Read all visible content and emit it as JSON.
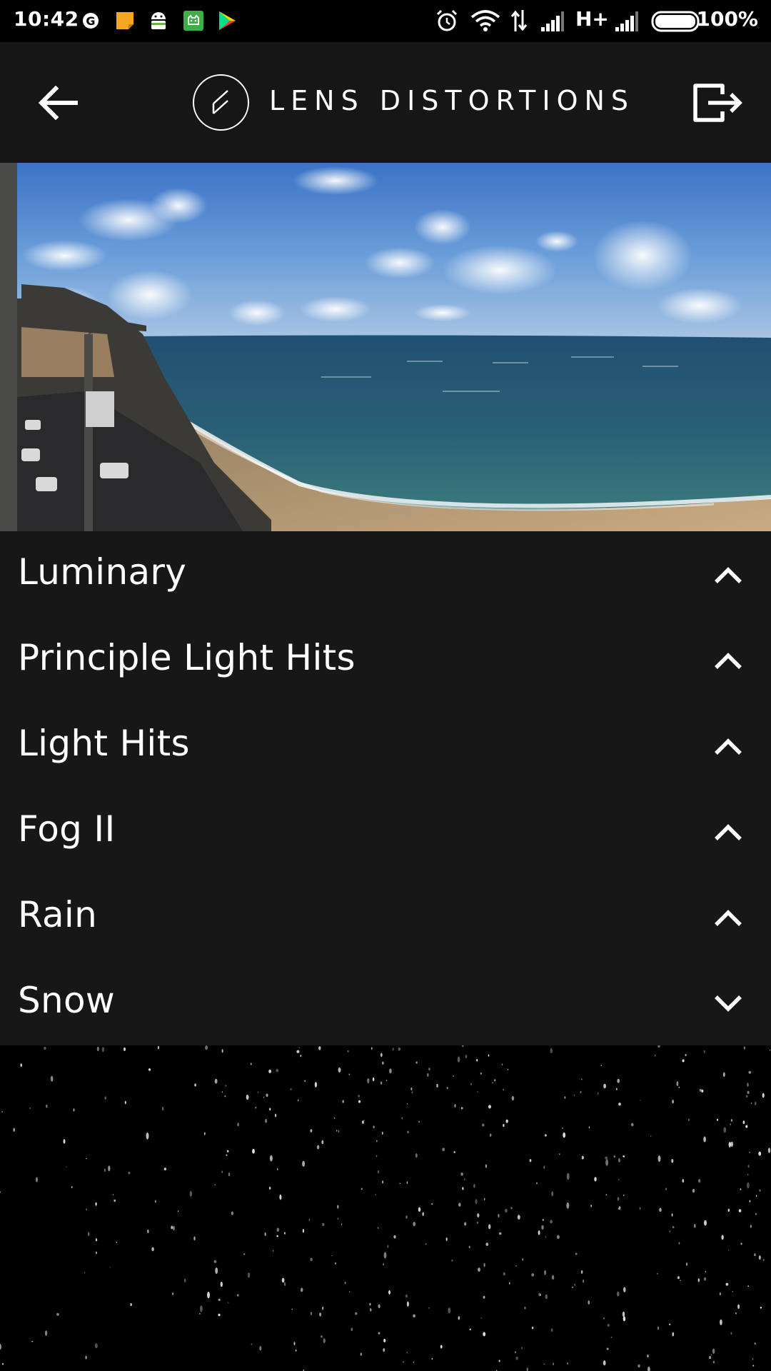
{
  "status_bar": {
    "time": "10:42",
    "network": "H+",
    "battery_percent": "100%",
    "notification_icons": [
      "google-icon",
      "notes-icon",
      "android-icon",
      "android-cat-icon",
      "play-store-icon"
    ],
    "system_icons": [
      "alarm-icon",
      "wifi-icon",
      "data-transfer-icon",
      "signal-icon",
      "signal-icon",
      "battery-icon"
    ]
  },
  "app_bar": {
    "brand": "LENS DISTORTIONS",
    "back_icon": "arrow-left-icon",
    "exit_icon": "exit-icon",
    "logo_icon": "lens-distortions-logo"
  },
  "preview": {
    "description_icon": "landscape-photo"
  },
  "effects": [
    {
      "label": "Luminary",
      "expanded": false,
      "icon": "chevron-up-icon"
    },
    {
      "label": "Principle Light Hits",
      "expanded": false,
      "icon": "chevron-up-icon"
    },
    {
      "label": "Light Hits",
      "expanded": false,
      "icon": "chevron-up-icon"
    },
    {
      "label": "Fog II",
      "expanded": false,
      "icon": "chevron-up-icon"
    },
    {
      "label": "Rain",
      "expanded": false,
      "icon": "chevron-up-icon"
    },
    {
      "label": "Snow",
      "expanded": true,
      "icon": "chevron-down-icon"
    }
  ],
  "colors": {
    "status_bar_bg": "#000000",
    "app_bar_bg": "#161616",
    "list_bg": "#171717",
    "text": "#ffffff"
  }
}
